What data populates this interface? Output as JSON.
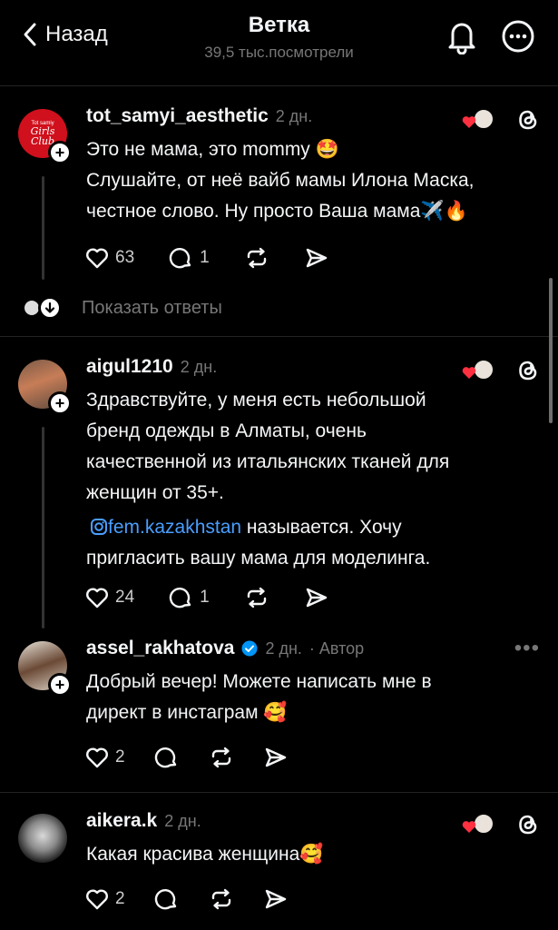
{
  "header": {
    "back_label": "Назад",
    "title": "Ветка",
    "views": "39,5 тыс.посмотрели"
  },
  "posts": [
    {
      "username": "tot_samyi_aesthetic",
      "time": "2 дн.",
      "lines": [
        "Это не мама, это mommy 🤩",
        "Слушайте, от неё вайб мамы Илона Маска,",
        "честное слово.  Ну просто Ваша мама✈️🔥"
      ],
      "likes": "63",
      "replies": "1",
      "avatar_text": [
        "Tot samiy",
        "Girls",
        "Club"
      ]
    },
    {
      "username": "aigul1210",
      "time": "2 дн.",
      "lines": [
        "Здравствуйте, у меня есть небольшой",
        "бренд одежды в Алматы, очень",
        "качественной  из итальянских тканей для",
        "женщин от 35+."
      ],
      "link": "fem.kazakhstan",
      "link_suffix": " называется. Хочу",
      "last_line": "пригласить вашу мама для моделинга.",
      "likes": "24",
      "replies": "1"
    },
    {
      "username": "assel_rakhatova",
      "time": "2 дн.",
      "author_label": "· Автор",
      "lines": [
        "Добрый вечер! Можете написать мне в",
        "директ в инстаграм 🥰"
      ],
      "likes": "2"
    },
    {
      "username": "aikera.k",
      "time": "2 дн.",
      "lines": [
        "Какая красива женщина🥰"
      ],
      "likes": "2"
    }
  ],
  "show_replies_label": "Показать ответы",
  "icons": {
    "back": "chevron-left-icon",
    "bell": "bell-icon",
    "more": "more-circle-icon",
    "like": "heart-icon",
    "reply": "comment-icon",
    "repost": "repost-icon",
    "share": "send-icon",
    "threads": "threads-logo-icon",
    "instagram": "instagram-icon",
    "verified": "verified-badge-icon"
  },
  "colors": {
    "background": "#000000",
    "text": "#f3f5f7",
    "muted": "#777777",
    "link": "#4a9eff",
    "verified": "#0095f6",
    "heart": "#ff3040"
  }
}
